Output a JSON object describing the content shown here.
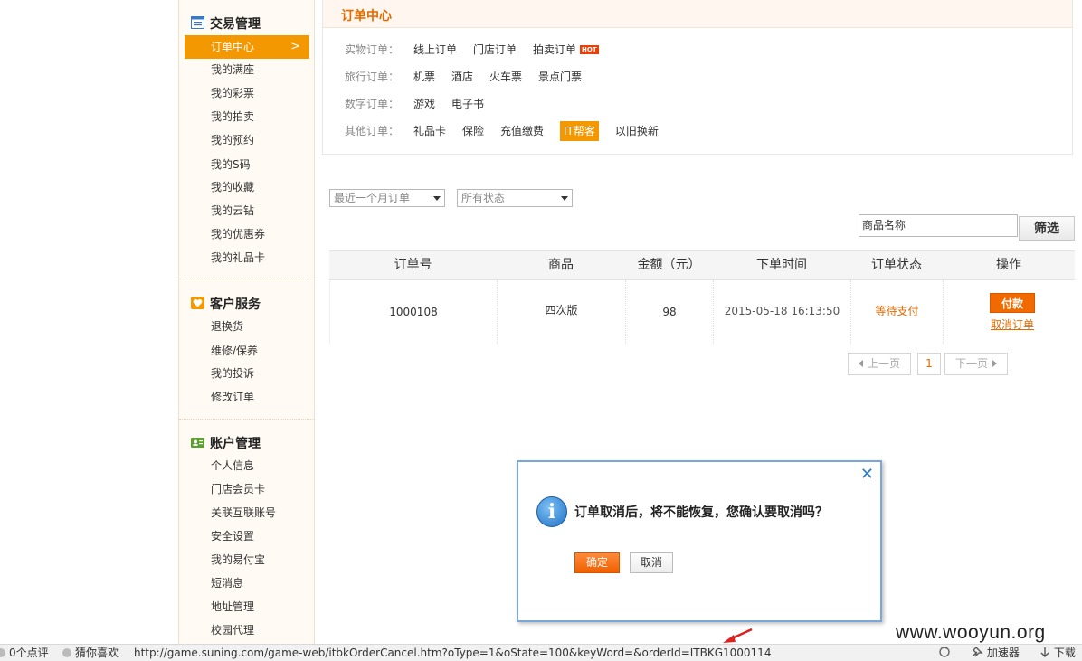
{
  "sidebar": {
    "sections": [
      {
        "title": "交易管理",
        "items": [
          "订单中心",
          "我的满座",
          "我的彩票",
          "我的拍卖",
          "我的预约",
          "我的S码",
          "我的收藏",
          "我的云钻",
          "我的优惠券",
          "我的礼品卡"
        ]
      },
      {
        "title": "客户服务",
        "items": [
          "退换货",
          "维修/保养",
          "我的投诉",
          "修改订单"
        ]
      },
      {
        "title": "账户管理",
        "items": [
          "个人信息",
          "门店会员卡",
          "关联互联账号",
          "安全设置",
          "我的易付宝",
          "短消息",
          "地址管理",
          "校园代理"
        ]
      }
    ],
    "active_chevron": ">"
  },
  "categories": {
    "title": "订单中心",
    "rows": [
      {
        "label": "实物订单：",
        "links": [
          "线上订单",
          "门店订单",
          "拍卖订单"
        ],
        "hot_badge": "HOT"
      },
      {
        "label": "旅行订单：",
        "links": [
          "机票",
          "酒店",
          "火车票",
          "景点门票"
        ]
      },
      {
        "label": "数字订单：",
        "links": [
          "游戏",
          "电子书"
        ]
      },
      {
        "label": "其他订单：",
        "links": [
          "礼品卡",
          "保险",
          "充值缴费",
          "IT帮客",
          "以旧换新"
        ],
        "active": "IT帮客"
      }
    ]
  },
  "filters": {
    "period": "最近一个月订单",
    "status": "所有状态",
    "search_value": "商品名称",
    "filter_button": "筛选"
  },
  "table": {
    "headers": [
      "订单号",
      "商品",
      "金额（元）",
      "下单时间",
      "订单状态",
      "操作"
    ],
    "rows": [
      {
        "order_no": "1000108",
        "product": "四次版",
        "amount": "98",
        "time": "2015-05-18 16:13:50",
        "status": "等待支付",
        "pay_label": "付款",
        "cancel_label": "取消订单"
      }
    ]
  },
  "pager": {
    "prev": "上一页",
    "current": "1",
    "next": "下一页"
  },
  "dialog": {
    "close_glyph": "✕",
    "icon_glyph": "i",
    "message": "订单取消后，将不能恢复，您确认要取消吗？",
    "ok": "确定",
    "cancel": "取消"
  },
  "watermark": "www.wooyun.org",
  "statusbar": {
    "comments": "0个点评",
    "guess": "猜你喜欢",
    "url": "http://game.suning.com/game-web/itbkOrderCancel.htm?oType=1&oState=100&keyWord=&orderId=ITBKG1000114",
    "accelerator": "加速器",
    "download": "下载"
  },
  "colors": {
    "accent": "#f39800",
    "accent_text": "#e26b00",
    "dialog_border": "#7aa7d8"
  }
}
